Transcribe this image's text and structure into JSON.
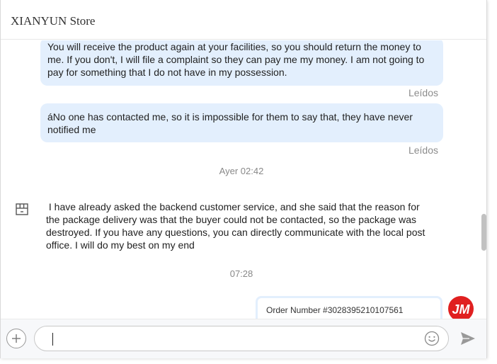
{
  "header": {
    "title": "XIANYUN Store"
  },
  "messages": {
    "m1": {
      "lines": [
        "You will receive the product again at your facilities, so you should return the money to",
        "me.  If you don't, I will file a complaint so they can pay me my money.  I am not going to",
        "pay for something that I do not have in my possession."
      ],
      "status": "Leídos"
    },
    "m2": {
      "lines": [
        "áNo one has contacted me, so it is impossible for them to say that, they have never",
        "notified me"
      ],
      "status": "Leídos"
    },
    "time1": "Ayer 02:42",
    "m3": {
      "lines": [
        " I have already asked the backend customer service, and she said that the reason for",
        "the package delivery was that the buyer could not be contacted, so the package was",
        "destroyed. If you have any questions, you can directly communicate with the local post",
        "office. I will do my best on my end"
      ]
    },
    "time2": "07:28",
    "order": {
      "label": "Order Number #3028395210107561"
    }
  },
  "input": {
    "value": "",
    "placeholder": ""
  },
  "icons": {
    "shop": "shop-icon",
    "user_avatar": "user-avatar-icon",
    "add": "plus-icon",
    "emoji": "smiley-icon",
    "send": "send-icon"
  },
  "colors": {
    "bubble": "#e3effd",
    "read_status": "#8c8c8c",
    "user_avatar": "#e02020"
  }
}
